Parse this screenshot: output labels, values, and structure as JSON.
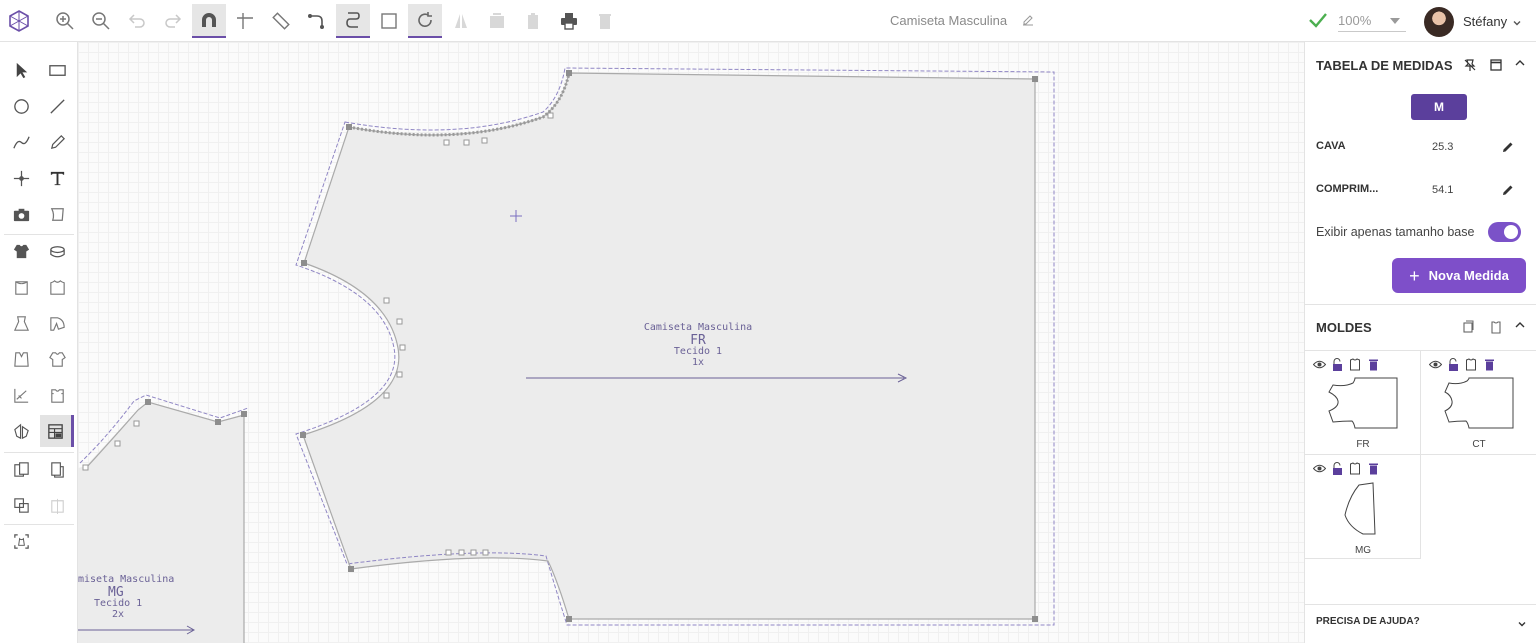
{
  "header": {
    "document_title": "Camiseta Masculina",
    "zoom": "100%",
    "user_name": "Stéfany"
  },
  "measurements": {
    "title": "TABELA DE MEDIDAS",
    "size": "M",
    "rows": [
      {
        "name": "CAVA",
        "value": "25.3"
      },
      {
        "name": "COMPRIM...",
        "value": "54.1"
      }
    ],
    "toggle_label": "Exibir apenas tamanho base",
    "toggle_on": true,
    "add_button": "Nova Medida"
  },
  "molds": {
    "title": "MOLDES",
    "items": [
      {
        "code": "FR"
      },
      {
        "code": "CT"
      },
      {
        "code": "MG"
      }
    ]
  },
  "canvas": {
    "pieces": [
      {
        "name": "Camiseta Masculina",
        "code": "FR",
        "fabric": "Tecido 1",
        "qty": "1x"
      },
      {
        "name": "miseta Masculina",
        "code": "MG",
        "fabric": "Tecido 1",
        "qty": "2x"
      }
    ]
  },
  "help": {
    "label": "PRECISA DE AJUDA?"
  },
  "colors": {
    "accent": "#7e4fc9",
    "accent_dark": "#5b3f9c",
    "check_green": "#4caf50"
  }
}
